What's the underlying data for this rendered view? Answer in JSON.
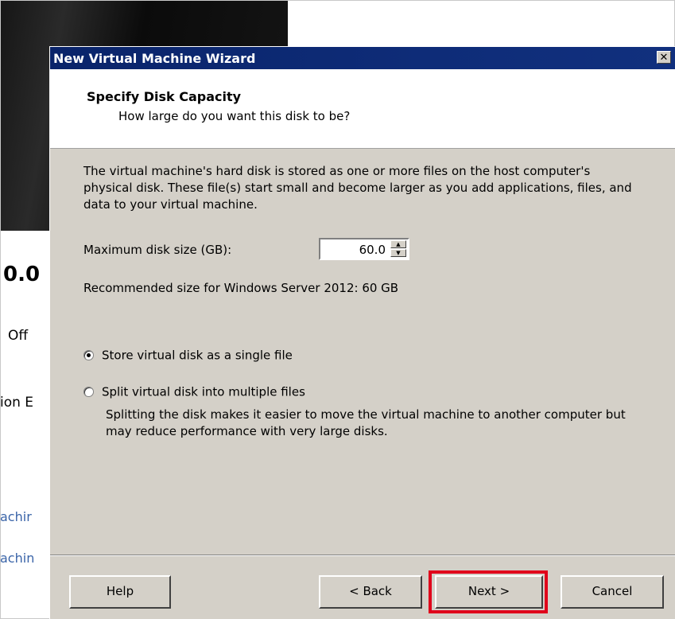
{
  "background_app": {
    "version_fragment": "0.0",
    "state_fragment": "Off",
    "edition_fragment": "ion E",
    "link1_fragment": "achir",
    "link2_fragment": "achin"
  },
  "wizard": {
    "title": "New Virtual Machine Wizard",
    "close_glyph": "✕",
    "header": {
      "title": "Specify Disk Capacity",
      "subtitle": "How large do you want this disk to be?"
    },
    "description": "The virtual machine's hard disk is stored as one or more files on the host computer's physical disk. These file(s) start small and become larger as you add applications, files, and data to your virtual machine.",
    "disk_size": {
      "label": "Maximum disk size (GB):",
      "value": "60.0"
    },
    "recommended": "Recommended size for Windows Server 2012: 60 GB",
    "options": {
      "single": {
        "label": "Store virtual disk as a single file",
        "selected": true
      },
      "multiple": {
        "label": "Split virtual disk into multiple files",
        "selected": false
      }
    },
    "split_note": "Splitting the disk makes it easier to move the virtual machine to another computer but may reduce performance with very large disks.",
    "buttons": {
      "help": "Help",
      "back": "< Back",
      "next": "Next >",
      "cancel": "Cancel"
    },
    "highlight_color": "#e0001b"
  }
}
